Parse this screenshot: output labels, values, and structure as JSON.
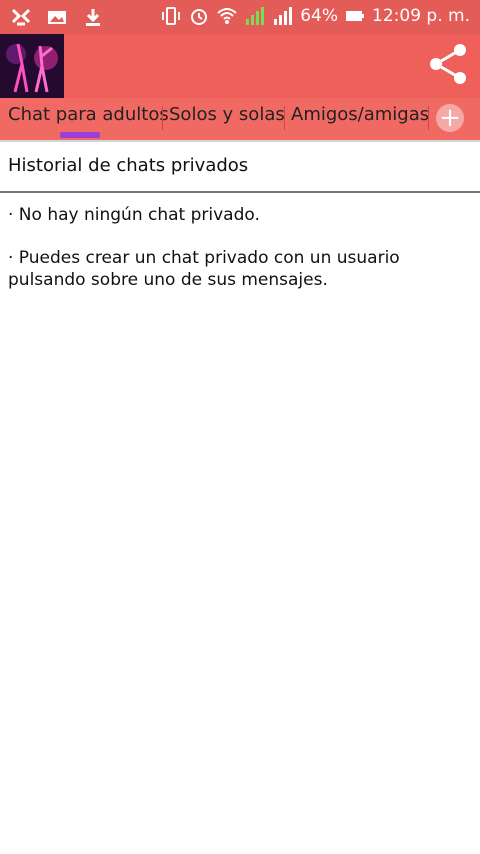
{
  "status": {
    "battery": "64%",
    "time": "12:09 p. m.",
    "sim_label": "2"
  },
  "tabs": [
    {
      "label": "Chat para adultos"
    },
    {
      "label": "Solos y solas"
    },
    {
      "label": "Amigos/amigas"
    }
  ],
  "add_tab_label": "+",
  "content": {
    "title": "Historial de chats privados",
    "msg1": "· No hay ningún chat privado.",
    "msg2": "· Puedes crear un chat privado con un usuario pulsando sobre uno de sus mensajes."
  },
  "colors": {
    "appbar": "#f0605a",
    "statusbar": "#e35c57",
    "indicator": "#9b3fd9"
  }
}
